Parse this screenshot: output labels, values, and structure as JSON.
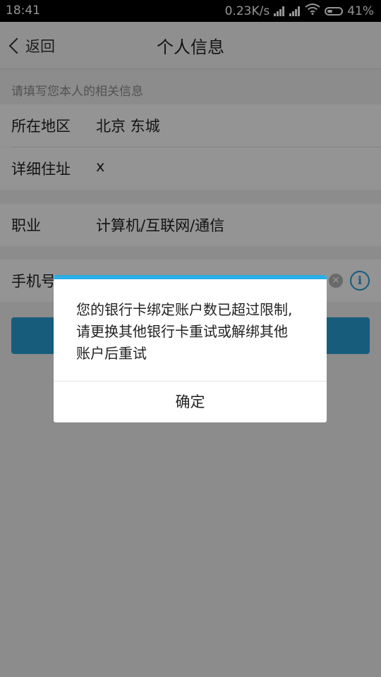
{
  "status_bar": {
    "time": "18:41",
    "net_speed": "0.23K/s",
    "battery_percent": "41%",
    "battery_level": 0.41,
    "icons": [
      "signal-icon",
      "signal-icon",
      "wifi-icon",
      "battery-icon"
    ]
  },
  "nav": {
    "back_label": "返回",
    "title": "个人信息"
  },
  "form": {
    "hint": "请填写您本人的相关信息",
    "region_label": "所在地区",
    "region_value": "北京 东城",
    "address_label": "详细住址",
    "address_value": "x",
    "job_label": "职业",
    "job_value": "计算机/互联网/通信",
    "phone_label": "手机号"
  },
  "dialog": {
    "message": "您的银行卡绑定账户数已超过限制,请更换其他银行卡重试或解绑其他账户后重试",
    "ok_label": "确定"
  },
  "colors": {
    "accent": "#2a9fd6",
    "overlay": "rgba(0,0,0,0.42)"
  }
}
